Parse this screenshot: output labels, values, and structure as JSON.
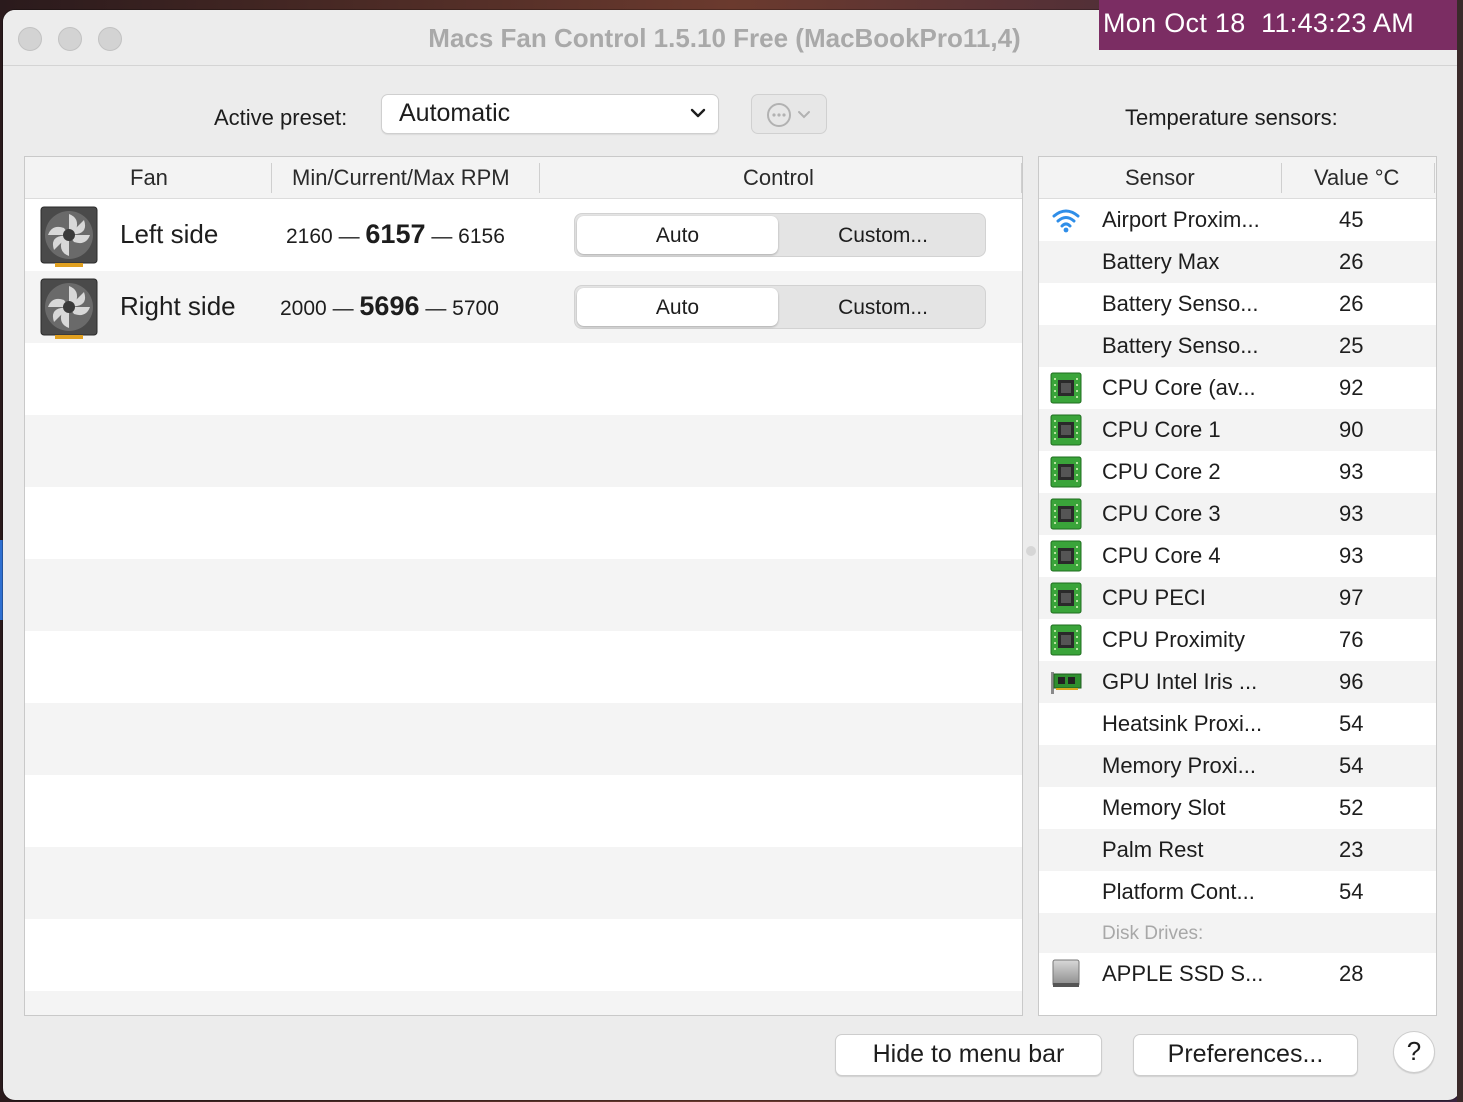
{
  "window": {
    "title": "Macs Fan Control 1.5.10 Free (MacBookPro11,4)"
  },
  "menubar_clock": "Mon Oct 18  11:43:23 AM",
  "preset": {
    "label": "Active preset:",
    "value": "Automatic"
  },
  "temperature_label": "Temperature sensors:",
  "fan_table": {
    "columns": [
      "Fan",
      "Min/Current/Max RPM",
      "Control"
    ],
    "rows": [
      {
        "name": "Left side",
        "min": "2160",
        "current": "6157",
        "max": "6156",
        "auto": "Auto",
        "custom": "Custom..."
      },
      {
        "name": "Right side",
        "min": "2000",
        "current": "5696",
        "max": "5700",
        "auto": "Auto",
        "custom": "Custom..."
      }
    ]
  },
  "rpm_separator": "—",
  "sensor_table": {
    "columns": [
      "Sensor",
      "Value °C"
    ],
    "rows": [
      {
        "icon": "wifi-icon",
        "name": "Airport Proxim...",
        "value": "45"
      },
      {
        "icon": "",
        "name": "Battery Max",
        "value": "26"
      },
      {
        "icon": "",
        "name": "Battery Senso...",
        "value": "26"
      },
      {
        "icon": "",
        "name": "Battery Senso...",
        "value": "25"
      },
      {
        "icon": "cpu-chip-icon",
        "name": "CPU Core (av...",
        "value": "92"
      },
      {
        "icon": "cpu-chip-icon",
        "name": "CPU Core 1",
        "value": "90"
      },
      {
        "icon": "cpu-chip-icon",
        "name": "CPU Core 2",
        "value": "93"
      },
      {
        "icon": "cpu-chip-icon",
        "name": "CPU Core 3",
        "value": "93"
      },
      {
        "icon": "cpu-chip-icon",
        "name": "CPU Core 4",
        "value": "93"
      },
      {
        "icon": "cpu-chip-icon",
        "name": "CPU PECI",
        "value": "97"
      },
      {
        "icon": "cpu-chip-icon",
        "name": "CPU Proximity",
        "value": "76"
      },
      {
        "icon": "gpu-card-icon",
        "name": "GPU Intel Iris ...",
        "value": "96"
      },
      {
        "icon": "",
        "name": "Heatsink Proxi...",
        "value": "54"
      },
      {
        "icon": "",
        "name": "Memory Proxi...",
        "value": "54"
      },
      {
        "icon": "",
        "name": "Memory Slot",
        "value": "52"
      },
      {
        "icon": "",
        "name": "Palm Rest",
        "value": "23"
      },
      {
        "icon": "",
        "name": "Platform Cont...",
        "value": "54"
      }
    ],
    "section_label": "Disk Drives:",
    "disk_rows": [
      {
        "icon": "ssd-drive-icon",
        "name": "APPLE SSD S...",
        "value": "28"
      }
    ]
  },
  "buttons": {
    "hide": "Hide to menu bar",
    "preferences": "Preferences...",
    "help": "?"
  },
  "colors": {
    "clock_bg": "#7b2d63",
    "chip_green": "#3aa43a"
  }
}
